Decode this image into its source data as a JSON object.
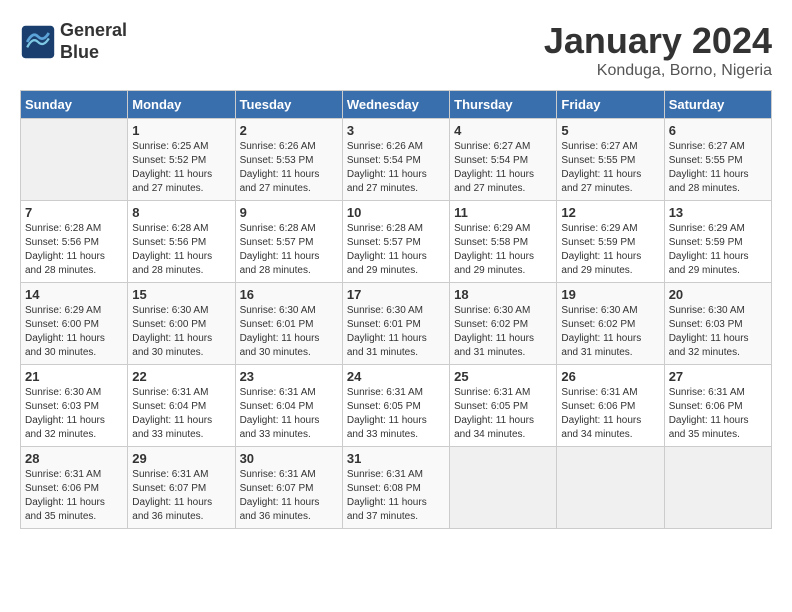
{
  "logo": {
    "line1": "General",
    "line2": "Blue"
  },
  "title": "January 2024",
  "subtitle": "Konduga, Borno, Nigeria",
  "headers": [
    "Sunday",
    "Monday",
    "Tuesday",
    "Wednesday",
    "Thursday",
    "Friday",
    "Saturday"
  ],
  "weeks": [
    [
      {
        "day": "",
        "sunrise": "",
        "sunset": "",
        "daylight": ""
      },
      {
        "day": "1",
        "sunrise": "Sunrise: 6:25 AM",
        "sunset": "Sunset: 5:52 PM",
        "daylight": "Daylight: 11 hours and 27 minutes."
      },
      {
        "day": "2",
        "sunrise": "Sunrise: 6:26 AM",
        "sunset": "Sunset: 5:53 PM",
        "daylight": "Daylight: 11 hours and 27 minutes."
      },
      {
        "day": "3",
        "sunrise": "Sunrise: 6:26 AM",
        "sunset": "Sunset: 5:54 PM",
        "daylight": "Daylight: 11 hours and 27 minutes."
      },
      {
        "day": "4",
        "sunrise": "Sunrise: 6:27 AM",
        "sunset": "Sunset: 5:54 PM",
        "daylight": "Daylight: 11 hours and 27 minutes."
      },
      {
        "day": "5",
        "sunrise": "Sunrise: 6:27 AM",
        "sunset": "Sunset: 5:55 PM",
        "daylight": "Daylight: 11 hours and 27 minutes."
      },
      {
        "day": "6",
        "sunrise": "Sunrise: 6:27 AM",
        "sunset": "Sunset: 5:55 PM",
        "daylight": "Daylight: 11 hours and 28 minutes."
      }
    ],
    [
      {
        "day": "7",
        "sunrise": "Sunrise: 6:28 AM",
        "sunset": "Sunset: 5:56 PM",
        "daylight": "Daylight: 11 hours and 28 minutes."
      },
      {
        "day": "8",
        "sunrise": "Sunrise: 6:28 AM",
        "sunset": "Sunset: 5:56 PM",
        "daylight": "Daylight: 11 hours and 28 minutes."
      },
      {
        "day": "9",
        "sunrise": "Sunrise: 6:28 AM",
        "sunset": "Sunset: 5:57 PM",
        "daylight": "Daylight: 11 hours and 28 minutes."
      },
      {
        "day": "10",
        "sunrise": "Sunrise: 6:28 AM",
        "sunset": "Sunset: 5:57 PM",
        "daylight": "Daylight: 11 hours and 29 minutes."
      },
      {
        "day": "11",
        "sunrise": "Sunrise: 6:29 AM",
        "sunset": "Sunset: 5:58 PM",
        "daylight": "Daylight: 11 hours and 29 minutes."
      },
      {
        "day": "12",
        "sunrise": "Sunrise: 6:29 AM",
        "sunset": "Sunset: 5:59 PM",
        "daylight": "Daylight: 11 hours and 29 minutes."
      },
      {
        "day": "13",
        "sunrise": "Sunrise: 6:29 AM",
        "sunset": "Sunset: 5:59 PM",
        "daylight": "Daylight: 11 hours and 29 minutes."
      }
    ],
    [
      {
        "day": "14",
        "sunrise": "Sunrise: 6:29 AM",
        "sunset": "Sunset: 6:00 PM",
        "daylight": "Daylight: 11 hours and 30 minutes."
      },
      {
        "day": "15",
        "sunrise": "Sunrise: 6:30 AM",
        "sunset": "Sunset: 6:00 PM",
        "daylight": "Daylight: 11 hours and 30 minutes."
      },
      {
        "day": "16",
        "sunrise": "Sunrise: 6:30 AM",
        "sunset": "Sunset: 6:01 PM",
        "daylight": "Daylight: 11 hours and 30 minutes."
      },
      {
        "day": "17",
        "sunrise": "Sunrise: 6:30 AM",
        "sunset": "Sunset: 6:01 PM",
        "daylight": "Daylight: 11 hours and 31 minutes."
      },
      {
        "day": "18",
        "sunrise": "Sunrise: 6:30 AM",
        "sunset": "Sunset: 6:02 PM",
        "daylight": "Daylight: 11 hours and 31 minutes."
      },
      {
        "day": "19",
        "sunrise": "Sunrise: 6:30 AM",
        "sunset": "Sunset: 6:02 PM",
        "daylight": "Daylight: 11 hours and 31 minutes."
      },
      {
        "day": "20",
        "sunrise": "Sunrise: 6:30 AM",
        "sunset": "Sunset: 6:03 PM",
        "daylight": "Daylight: 11 hours and 32 minutes."
      }
    ],
    [
      {
        "day": "21",
        "sunrise": "Sunrise: 6:30 AM",
        "sunset": "Sunset: 6:03 PM",
        "daylight": "Daylight: 11 hours and 32 minutes."
      },
      {
        "day": "22",
        "sunrise": "Sunrise: 6:31 AM",
        "sunset": "Sunset: 6:04 PM",
        "daylight": "Daylight: 11 hours and 33 minutes."
      },
      {
        "day": "23",
        "sunrise": "Sunrise: 6:31 AM",
        "sunset": "Sunset: 6:04 PM",
        "daylight": "Daylight: 11 hours and 33 minutes."
      },
      {
        "day": "24",
        "sunrise": "Sunrise: 6:31 AM",
        "sunset": "Sunset: 6:05 PM",
        "daylight": "Daylight: 11 hours and 33 minutes."
      },
      {
        "day": "25",
        "sunrise": "Sunrise: 6:31 AM",
        "sunset": "Sunset: 6:05 PM",
        "daylight": "Daylight: 11 hours and 34 minutes."
      },
      {
        "day": "26",
        "sunrise": "Sunrise: 6:31 AM",
        "sunset": "Sunset: 6:06 PM",
        "daylight": "Daylight: 11 hours and 34 minutes."
      },
      {
        "day": "27",
        "sunrise": "Sunrise: 6:31 AM",
        "sunset": "Sunset: 6:06 PM",
        "daylight": "Daylight: 11 hours and 35 minutes."
      }
    ],
    [
      {
        "day": "28",
        "sunrise": "Sunrise: 6:31 AM",
        "sunset": "Sunset: 6:06 PM",
        "daylight": "Daylight: 11 hours and 35 minutes."
      },
      {
        "day": "29",
        "sunrise": "Sunrise: 6:31 AM",
        "sunset": "Sunset: 6:07 PM",
        "daylight": "Daylight: 11 hours and 36 minutes."
      },
      {
        "day": "30",
        "sunrise": "Sunrise: 6:31 AM",
        "sunset": "Sunset: 6:07 PM",
        "daylight": "Daylight: 11 hours and 36 minutes."
      },
      {
        "day": "31",
        "sunrise": "Sunrise: 6:31 AM",
        "sunset": "Sunset: 6:08 PM",
        "daylight": "Daylight: 11 hours and 37 minutes."
      },
      {
        "day": "",
        "sunrise": "",
        "sunset": "",
        "daylight": ""
      },
      {
        "day": "",
        "sunrise": "",
        "sunset": "",
        "daylight": ""
      },
      {
        "day": "",
        "sunrise": "",
        "sunset": "",
        "daylight": ""
      }
    ]
  ]
}
